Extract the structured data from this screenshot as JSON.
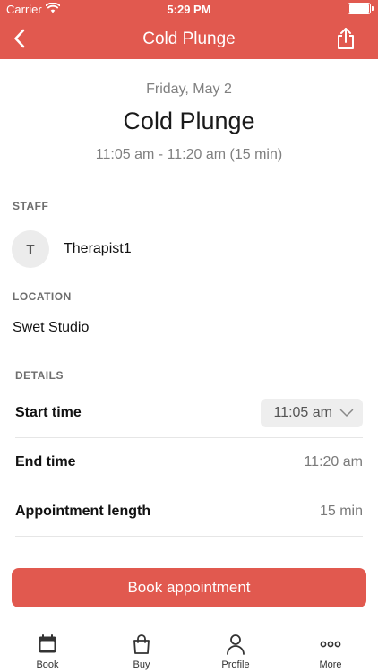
{
  "status_bar": {
    "carrier": "Carrier",
    "time": "5:29 PM",
    "battery_level": 1.0
  },
  "nav": {
    "title": "Cold Plunge",
    "back_icon": "chevron-left-icon",
    "share_icon": "share-icon"
  },
  "summary": {
    "date": "Friday, May 2",
    "title": "Cold Plunge",
    "time": "11:05 am - 11:20 am (15 min)"
  },
  "staff": {
    "section_label": "STAFF",
    "avatar_initial": "T",
    "name": "Therapist1"
  },
  "location": {
    "section_label": "LOCATION",
    "name": "Swet Studio"
  },
  "details": {
    "section_label": "DETAILS",
    "start_time": {
      "label": "Start time",
      "value": "11:05 am"
    },
    "end_time": {
      "label": "End time",
      "value": "11:20 am"
    },
    "length": {
      "label": "Appointment length",
      "value": "15 min"
    }
  },
  "book_button": {
    "label": "Book appointment"
  },
  "tabs": [
    {
      "label": "Book",
      "icon": "calendar-icon",
      "active": true
    },
    {
      "label": "Buy",
      "icon": "shopping-bag-icon",
      "active": false
    },
    {
      "label": "Profile",
      "icon": "person-icon",
      "active": false
    },
    {
      "label": "More",
      "icon": "ellipsis-icon",
      "active": false
    }
  ],
  "colors": {
    "accent": "#e1594f",
    "muted_text": "#808080",
    "select_bg": "#eeeeee"
  }
}
